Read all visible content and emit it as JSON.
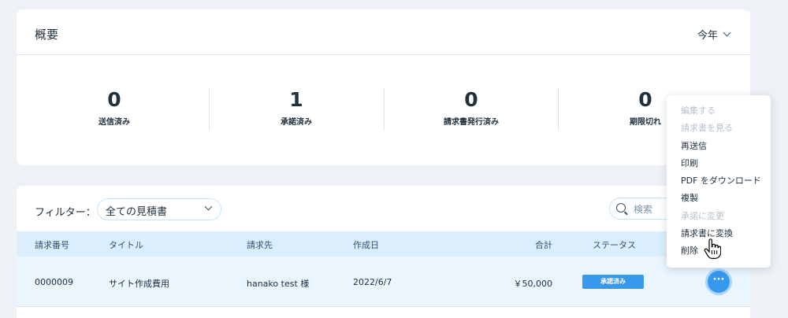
{
  "overview": {
    "title": "概要",
    "period": "今年",
    "stats": [
      {
        "value": "0",
        "label": "送信済み"
      },
      {
        "value": "1",
        "label": "承諾済み"
      },
      {
        "value": "0",
        "label": "請求書発行済み"
      },
      {
        "value": "0",
        "label": "期限切れ"
      }
    ]
  },
  "list": {
    "filter_label": "フィルター：",
    "filter_value": "全ての見積書",
    "search_placeholder": "検索",
    "columns": {
      "number": "請求番号",
      "title": "タイトル",
      "client": "請求先",
      "created": "作成日",
      "total": "合計",
      "status": "ステータス"
    },
    "rows": [
      {
        "number": "0000009",
        "title": "サイト作成費用",
        "client": "hanako test 様",
        "created": "2022/6/7",
        "total": "￥50,000",
        "status": "承諾済み"
      }
    ],
    "more_label": "···"
  },
  "menu": {
    "items": [
      {
        "label": "編集する",
        "enabled": false
      },
      {
        "label": "請求書を見る",
        "enabled": false
      },
      {
        "label": "再送信",
        "enabled": true
      },
      {
        "label": "印刷",
        "enabled": true
      },
      {
        "label": "PDF をダウンロード",
        "enabled": true
      },
      {
        "label": "複製",
        "enabled": true
      },
      {
        "label": "承諾に変更",
        "enabled": false
      },
      {
        "label": "請求書に変換",
        "enabled": true
      },
      {
        "label": "削除",
        "enabled": true
      }
    ]
  },
  "colors": {
    "accent": "#3899ec",
    "header_bg": "#daeefd",
    "row_bg": "#eaf5fe",
    "page_bg": "#eef1f5"
  }
}
